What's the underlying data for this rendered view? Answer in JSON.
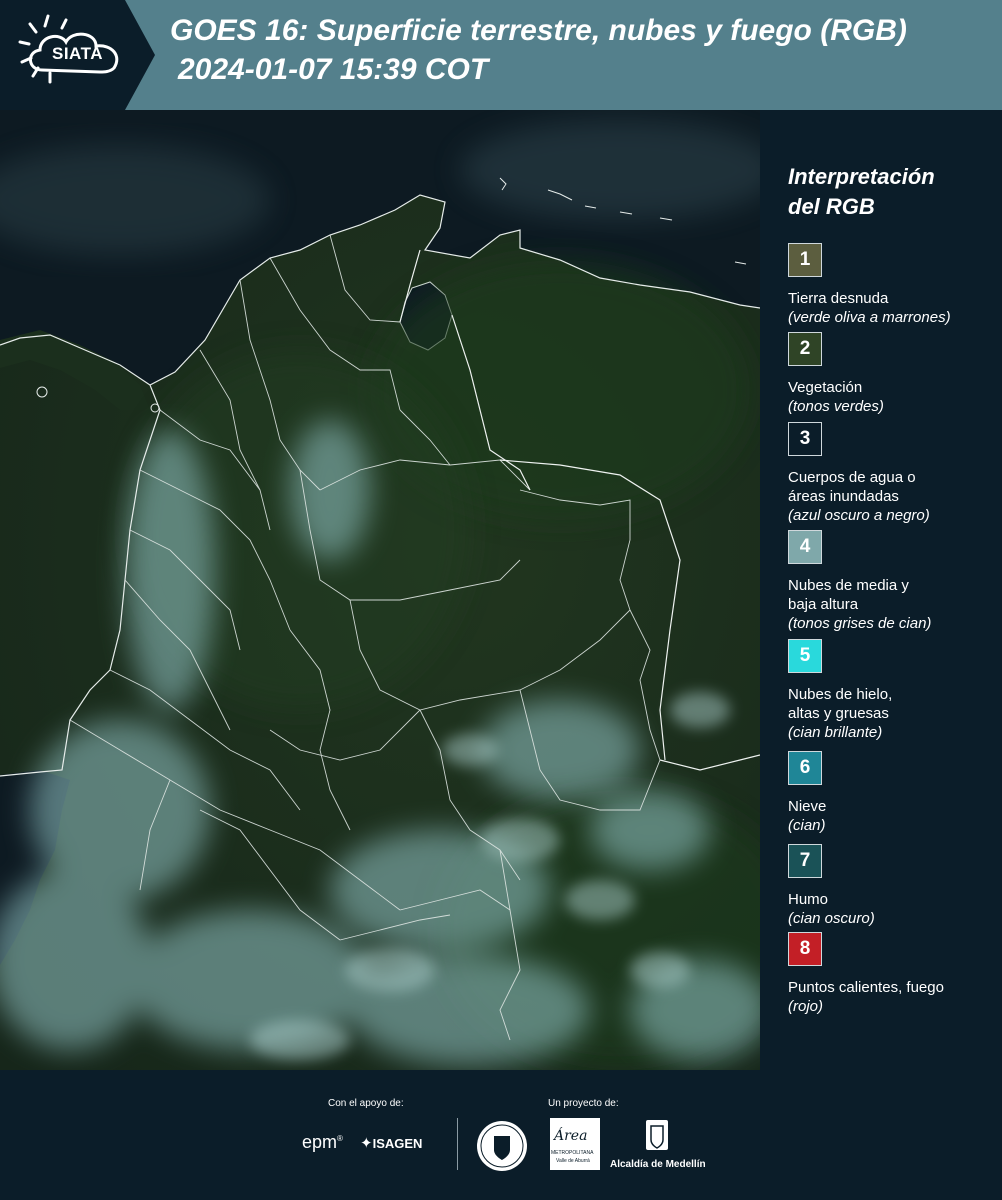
{
  "header": {
    "logo_text": "SIATA",
    "title_line1": "GOES 16: Superficie terrestre, nubes y fuego (RGB)",
    "title_line2": "2024-01-07 15:39 COT",
    "background_color": "#54808c",
    "logo_background_color": "#0b1d29"
  },
  "map": {
    "description_icon": "satellite-rgb-image",
    "boundary_color": "#dfe6e3"
  },
  "legend": {
    "title": "Interpretación\ndel RGB",
    "items": [
      {
        "number": "1",
        "label": "Tierra desnuda",
        "desc": "(verde oliva a marrones)",
        "color": "#5c5e3f"
      },
      {
        "number": "2",
        "label": "Vegetación",
        "desc": "(tonos verdes)",
        "color": "#2f4426"
      },
      {
        "number": "3",
        "label": "Cuerpos de agua o\náreas inundadas",
        "desc": "(azul oscuro a negro)",
        "color": "#0b1d29"
      },
      {
        "number": "4",
        "label": "Nubes de media y\nbaja altura",
        "desc": "(tonos grises de cian)",
        "color": "#7fa8aa"
      },
      {
        "number": "5",
        "label": "Nubes de hielo,\naltas y gruesas",
        "desc": "(cian brillante)",
        "color": "#29d9dc"
      },
      {
        "number": "6",
        "label": "Nieve",
        "desc": "(cian)",
        "color": "#1f8697"
      },
      {
        "number": "7",
        "label": "Humo",
        "desc": "(cian oscuro)",
        "color": "#1a5257"
      },
      {
        "number": "8",
        "label": "Puntos calientes, fuego",
        "desc": "(rojo)",
        "color": "#c31f26"
      }
    ]
  },
  "footer": {
    "support_label": "Con el apoyo de:",
    "project_label": "Un proyecto de:",
    "brands": {
      "epm": "epm",
      "isagen": "ISAGEN",
      "area_metro": "METROPOLITANA",
      "area_metro_sub": "Valle de Aburrá",
      "alcaldia": "Alcaldía de Medellín"
    }
  }
}
